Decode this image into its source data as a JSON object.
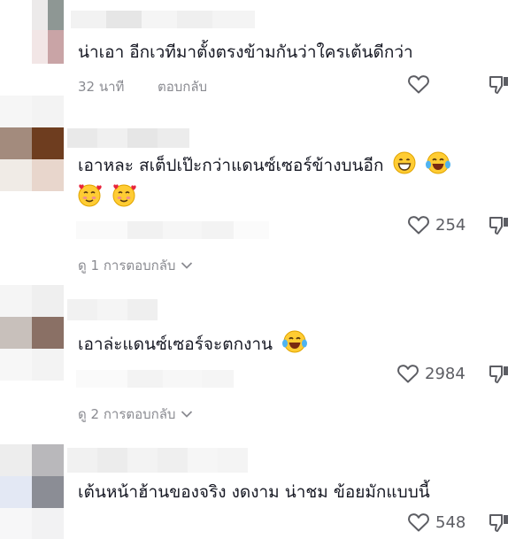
{
  "comments": [
    {
      "text": "น่าเอา อีกเวทีมาตั้งตรงข้ามกันว่าใครเต้นดีกว่า",
      "time": "32 นาที",
      "reply_label": "ตอบกลับ",
      "like_count": ""
    },
    {
      "text": "เอาหละ สเต็ปเป๊ะกว่าแดนซ์เซอร์ข้างบนอีก",
      "like_count": "254",
      "view_replies": "ดู 1 การตอบกลับ"
    },
    {
      "text": "เอาล่ะแดนซ์เซอร์จะตกงาน",
      "like_count": "2984",
      "view_replies": "ดู 2 การตอบกลับ"
    },
    {
      "text": "เต้นหน้าฮ้านของจริง งดงาม น่าชม ข้อยมักแบบนี้",
      "like_count": "548"
    }
  ],
  "icons": {
    "like": "heart-icon",
    "dislike": "thumbs-down-icon",
    "expand": "chevron-down-icon",
    "emoji_grin": "grinning-emoji",
    "emoji_laugh": "tears-of-joy-emoji",
    "emoji_love": "smiling-hearts-emoji"
  },
  "colors": {
    "text": "#161823",
    "secondary": "#8a8b91",
    "icon": "#5c5d63"
  }
}
